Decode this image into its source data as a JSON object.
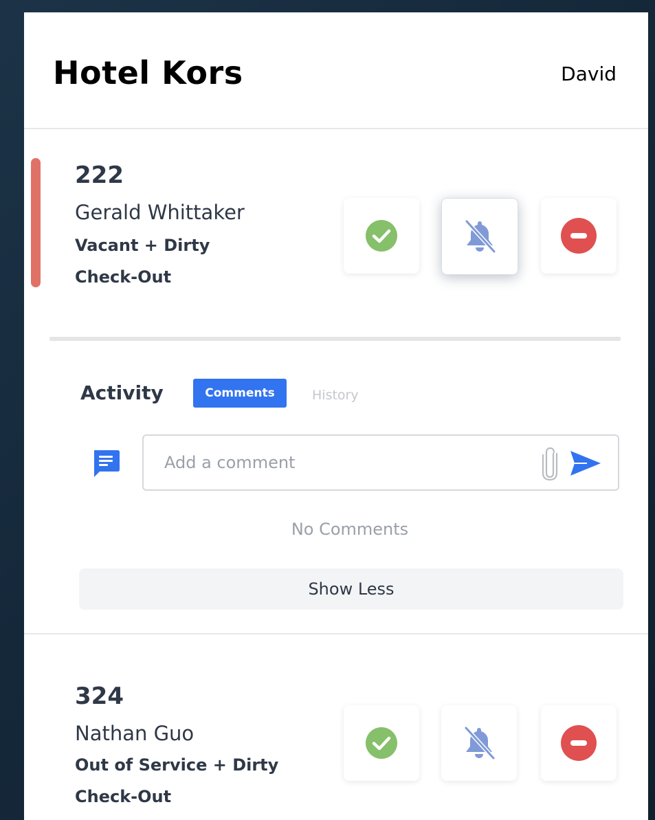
{
  "app": {
    "title": "Hotel Kors",
    "user_name": "David"
  },
  "colors": {
    "accent_dirty": "#e07167",
    "clean_green": "#86c06a",
    "dnd_blue": "#7f9ad7",
    "block_red": "#e05050",
    "tab_active": "#3273f0"
  },
  "rooms": [
    {
      "number": "222",
      "guest": "Gerald Whittaker",
      "status": "Vacant + Dirty",
      "movement": "Check-Out",
      "expanded": true,
      "active_action": "do-not-disturb",
      "actions": [
        {
          "name": "mark-clean",
          "icon": "check-circle-icon"
        },
        {
          "name": "do-not-disturb",
          "icon": "bell-slash-icon"
        },
        {
          "name": "block",
          "icon": "minus-circle-icon"
        }
      ],
      "activity": {
        "label": "Activity",
        "tabs": [
          {
            "label": "Comments",
            "active": true
          },
          {
            "label": "History",
            "active": false
          }
        ],
        "comment_placeholder": "Add a comment",
        "comment_value": "",
        "empty_text": "No Comments",
        "toggle_label": "Show Less"
      }
    },
    {
      "number": "324",
      "guest": "Nathan Guo",
      "status": "Out of Service + Dirty",
      "movement": "Check-Out",
      "expanded": false,
      "actions": [
        {
          "name": "mark-clean",
          "icon": "check-circle-icon"
        },
        {
          "name": "do-not-disturb",
          "icon": "bell-slash-icon"
        },
        {
          "name": "block",
          "icon": "minus-circle-icon"
        }
      ]
    }
  ]
}
